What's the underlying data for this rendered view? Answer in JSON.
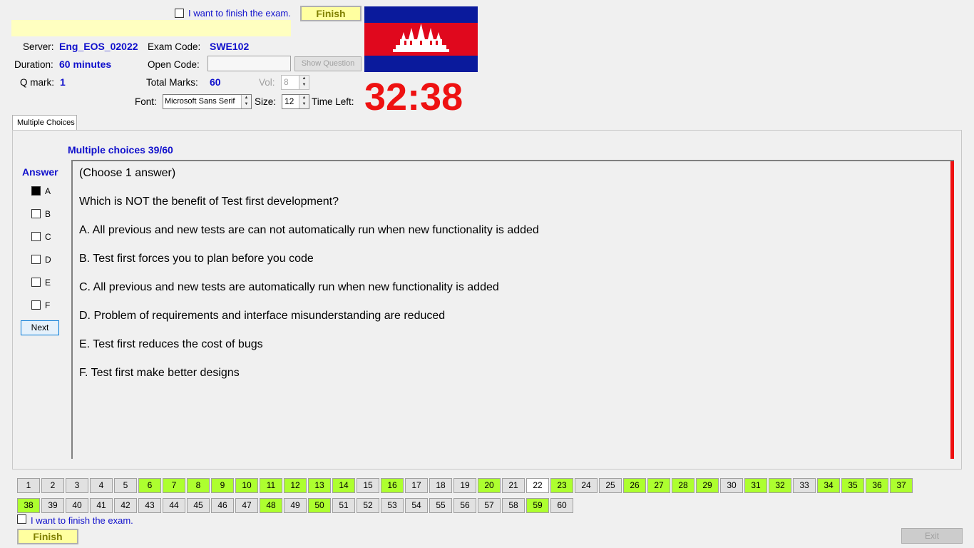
{
  "header": {
    "finish_check_label": "I want to finish the exam.",
    "finish_label": "Finish",
    "server_label": "Server:",
    "server_value": "Eng_EOS_02022",
    "exam_code_label": "Exam Code:",
    "exam_code_value": "SWE102",
    "duration_label": "Duration:",
    "duration_value": "60 minutes",
    "open_code_label": "Open Code:",
    "open_code_value": "",
    "show_question_label": "Show Question",
    "qmark_label": "Q mark:",
    "qmark_value": "1",
    "total_marks_label": "Total Marks:",
    "total_marks_value": "60",
    "vol_label": "Vol:",
    "vol_value": "8",
    "font_label": "Font:",
    "font_value": "Microsoft Sans Serif",
    "size_label": "Size:",
    "size_value": "12",
    "time_left_label": "Time Left:",
    "time_left_value": "32:38",
    "flag": "cambodia-flag"
  },
  "tab": {
    "label": "Multiple Choices"
  },
  "question": {
    "title": "Multiple choices 39/60",
    "answer_label": "Answer",
    "options": [
      {
        "letter": "A",
        "checked": true
      },
      {
        "letter": "B",
        "checked": false
      },
      {
        "letter": "C",
        "checked": false
      },
      {
        "letter": "D",
        "checked": false
      },
      {
        "letter": "E",
        "checked": false
      },
      {
        "letter": "F",
        "checked": false
      }
    ],
    "next_label": "Next",
    "instruction": "(Choose 1 answer)",
    "text": "Which is NOT the benefit of Test first development?",
    "choices": [
      "A.  All previous and new tests are can not automatically run when new functionality is added",
      "B.  Test first forces you to plan before you code",
      "C.  All previous and new tests are automatically run when new functionality is added",
      "D.  Problem of requirements and interface misunderstanding are reduced",
      "E.  Test first reduces the cost of bugs",
      "F.  Test first make better designs"
    ]
  },
  "navigator": {
    "answered": [
      6,
      7,
      8,
      9,
      10,
      11,
      12,
      13,
      14,
      16,
      20,
      23,
      26,
      27,
      28,
      29,
      31,
      32,
      34,
      35,
      36,
      37,
      38,
      48,
      50,
      59
    ],
    "current": 22,
    "total": 60
  },
  "footer": {
    "finish_check_label": "I want to finish the exam.",
    "finish_label": "Finish",
    "exit_label": "Exit"
  },
  "colors": {
    "value_blue": "#1010cc",
    "timer_red": "#ee1111",
    "answered_green": "#adff2f",
    "finish_yellow": "#ffffa0"
  }
}
